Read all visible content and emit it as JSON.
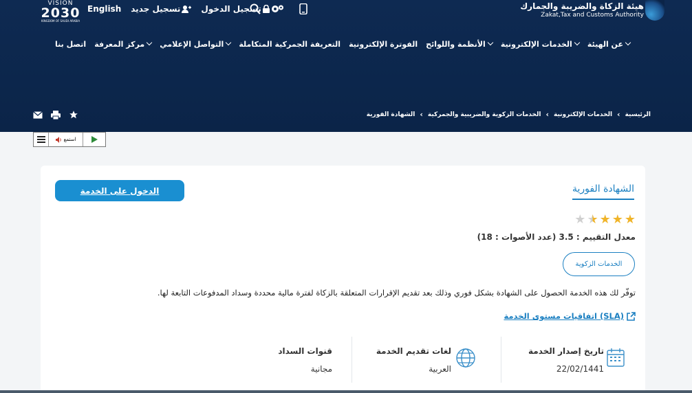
{
  "header": {
    "org_name_ar": "هيئة الزكاة والضريبة والجمارك",
    "org_name_en": "Zakat,Tax and Customs Authority",
    "vision_top": "VISION",
    "vision_year": "2030",
    "vision_kingdom": "KINGDOM OF SAUDI ARABIA",
    "links": {
      "english": "English",
      "register": "تسجيل جديد",
      "login": "تسجيل الدخول"
    },
    "icons": [
      "mobile-icon",
      "settings-icon",
      "search-icon",
      "lock-icon",
      "user-plus-icon"
    ]
  },
  "nav": {
    "items": [
      {
        "label": "عن الهيئة",
        "caret": true
      },
      {
        "label": "الخدمات الإلكترونية",
        "caret": true
      },
      {
        "label": "الأنظمة واللوائح",
        "caret": true
      },
      {
        "label": "الفوترة الإلكترونية",
        "caret": false
      },
      {
        "label": "التعريفة الجمركية المتكاملة",
        "caret": false
      },
      {
        "label": "التواصل الإعلامي",
        "caret": true
      },
      {
        "label": "مركز المعرفة",
        "caret": true
      },
      {
        "label": "اتصل بنا",
        "caret": false
      }
    ]
  },
  "breadcrumb": [
    "الرئيسية",
    "الخدمات الإلكترونية",
    "الخدمات الزكوية والضريبية والجمركية",
    "الشهادة الفورية"
  ],
  "player": {
    "listen_label": "استمع"
  },
  "service": {
    "title": "الشهادة الفورية",
    "enter_button": "الدخول على الخدمة",
    "rating_value": 3.5,
    "rating_text": "معدل التقييم : 3.5 (عدد الأصوات : 18)",
    "tag": "الخدمات الزكوية",
    "description": "توفّر لك هذه الخدمة الحصول على الشهادة بشكل فوري وذلك بعد تقديم الإقرارات المتعلقة بالزكاة لفترة مالية محددة وسداد المدفوعات التابعة لها.",
    "sla_link": "اتفاقيات مستوى الخدمة (SLA)",
    "facts": [
      {
        "label": "تاريخ إصدار الخدمة",
        "value": "22/02/1441",
        "icon": "calendar-icon"
      },
      {
        "label": "لغات تقديم الخدمة",
        "value": "العربية",
        "icon": "globe-icon"
      },
      {
        "label": "قنوات السداد",
        "value": "مجانية",
        "icon": ""
      }
    ]
  },
  "colors": {
    "header_bg": "#0e2a52",
    "accent": "#1a8fd1",
    "star": "#f0b429"
  }
}
